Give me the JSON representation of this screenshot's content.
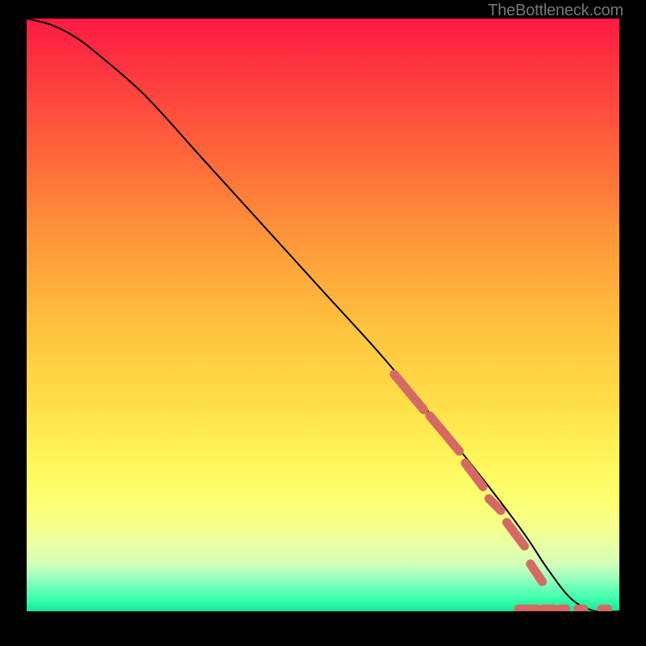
{
  "attribution": "TheBottleneck.com",
  "chart_data": {
    "type": "line",
    "title": "",
    "xlabel": "",
    "ylabel": "",
    "xlim": [
      0,
      100
    ],
    "ylim": [
      0,
      100
    ],
    "series": [
      {
        "name": "bottleneck-curve",
        "x": [
          0,
          4,
          8,
          12,
          20,
          30,
          40,
          50,
          60,
          70,
          78,
          84,
          88,
          92,
          96,
          100
        ],
        "y": [
          100,
          99,
          97,
          94,
          87,
          76,
          65,
          54,
          43,
          31,
          21,
          13,
          7,
          2,
          0,
          0
        ]
      }
    ],
    "highlight_segments": {
      "name": "intersection-markers",
      "color": "#d46a63",
      "segments": [
        {
          "x1": 62,
          "y1": 40,
          "x2": 67,
          "y2": 34
        },
        {
          "x1": 68,
          "y1": 33,
          "x2": 73,
          "y2": 27
        },
        {
          "x1": 74,
          "y1": 25,
          "x2": 77,
          "y2": 21
        },
        {
          "x1": 78,
          "y1": 19,
          "x2": 80,
          "y2": 17
        },
        {
          "x1": 81,
          "y1": 15,
          "x2": 84,
          "y2": 11
        },
        {
          "x1": 85,
          "y1": 8,
          "x2": 87,
          "y2": 5
        },
        {
          "x1": 83,
          "y1": 0.4,
          "x2": 86,
          "y2": 0.4
        },
        {
          "x1": 87,
          "y1": 0.4,
          "x2": 89,
          "y2": 0.4
        },
        {
          "x1": 90,
          "y1": 0.4,
          "x2": 91,
          "y2": 0.4
        },
        {
          "x1": 93,
          "y1": 0.4,
          "x2": 94,
          "y2": 0.4
        },
        {
          "x1": 97,
          "y1": 0.4,
          "x2": 98,
          "y2": 0.4
        }
      ]
    }
  }
}
